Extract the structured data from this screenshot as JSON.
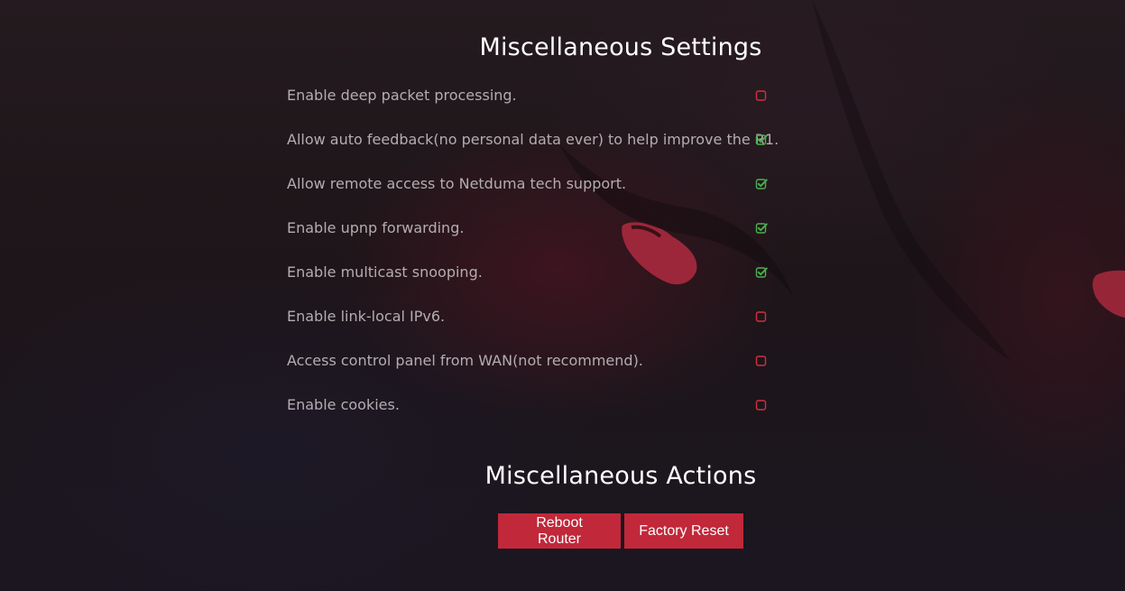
{
  "settings_section": {
    "title": "Miscellaneous Settings",
    "items": [
      {
        "label": "Enable deep packet processing.",
        "checked": false
      },
      {
        "label": "Allow auto feedback(no personal data ever) to help improve the R1.",
        "checked": true
      },
      {
        "label": "Allow remote access to Netduma tech support.",
        "checked": true
      },
      {
        "label": "Enable upnp forwarding.",
        "checked": true
      },
      {
        "label": "Enable multicast snooping.",
        "checked": true
      },
      {
        "label": "Enable link-local IPv6.",
        "checked": false
      },
      {
        "label": "Access control panel from WAN(not recommend).",
        "checked": false
      },
      {
        "label": "Enable cookies.",
        "checked": false
      }
    ]
  },
  "actions_section": {
    "title": "Miscellaneous Actions",
    "reboot_label": "Reboot Router",
    "factory_reset_label": "Factory Reset"
  },
  "colors": {
    "checked": "#4caf50",
    "unchecked": "#d0303f",
    "button": "#c1283a"
  }
}
